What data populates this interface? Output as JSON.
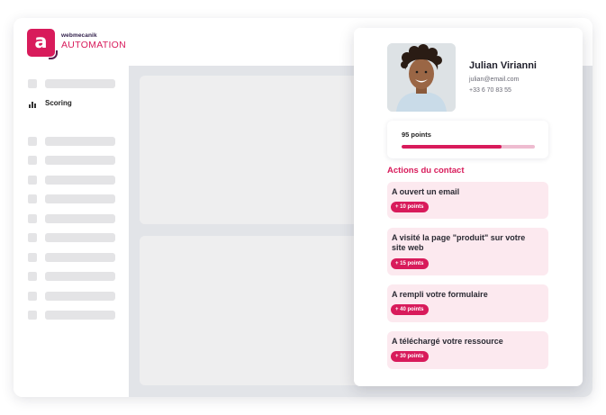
{
  "brand": {
    "name": "webmecanik",
    "product": "AUTOMATION",
    "accent": "#d81b5b",
    "logo_letter": "a"
  },
  "sidebar": {
    "active_item": {
      "label": "Scoring",
      "icon": "bar-chart-icon"
    }
  },
  "contact": {
    "name": "Julian Virianni",
    "email": "julian@email.com",
    "phone": "+33 6 70 83 55"
  },
  "score": {
    "label": "95 points",
    "progress": 0.75
  },
  "actions": {
    "title": "Actions du contact",
    "items": [
      {
        "text": "A ouvert un email",
        "points": "+ 10 points"
      },
      {
        "text": "A visité la page \"produit\" sur votre site web",
        "points": "+ 15 points"
      },
      {
        "text": "A rempli votre formulaire",
        "points": "+ 40 points"
      },
      {
        "text": "A téléchargé votre ressource",
        "points": "+ 30 points"
      }
    ]
  }
}
